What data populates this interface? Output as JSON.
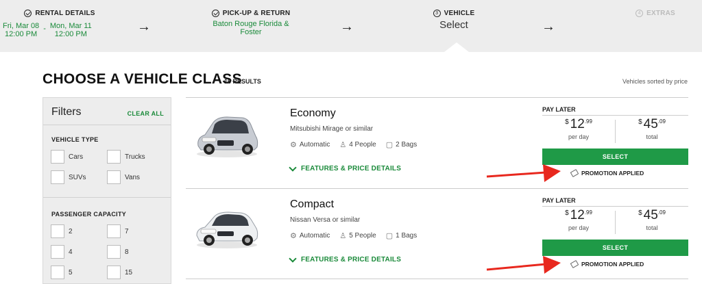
{
  "steps": {
    "rental": {
      "title": "RENTAL DETAILS",
      "from_day": "Fri, Mar 08",
      "from_time": "12:00 PM",
      "sep": "-",
      "to_day": "Mon, Mar 11",
      "to_time": "12:00 PM"
    },
    "pickup": {
      "title": "PICK-UP & RETURN",
      "location": "Baton Rouge Florida & Foster"
    },
    "vehicle": {
      "number": "3",
      "title": "VEHICLE",
      "value": "Select"
    },
    "extras": {
      "number": "4",
      "title": "EXTRAS"
    },
    "arrow_glyph": "→"
  },
  "heading": {
    "title": "CHOOSE A VEHICLE CLASS",
    "results": "16 RESULTS",
    "sorted": "Vehicles sorted by price"
  },
  "filters": {
    "title": "Filters",
    "clear": "CLEAR ALL",
    "vehicle_type": {
      "title": "VEHICLE TYPE",
      "options": [
        "Cars",
        "Trucks",
        "SUVs",
        "Vans"
      ]
    },
    "passenger_capacity": {
      "title": "PASSENGER CAPACITY",
      "options": [
        "2",
        "7",
        "4",
        "8",
        "5",
        "15"
      ]
    }
  },
  "vehicles": [
    {
      "name": "Economy",
      "model": "Mitsubishi Mirage or similar",
      "transmission": "Automatic",
      "people": "4 People",
      "bags": "2 Bags",
      "features": "FEATURES & PRICE DETAILS",
      "pay_label": "PAY LATER",
      "currency": "$",
      "per_day_amt": "12",
      "per_day_cents": ".99",
      "per_day_label": "per day",
      "total_amt": "45",
      "total_cents": ".09",
      "total_label": "total",
      "select": "SELECT",
      "promo": "PROMOTION APPLIED"
    },
    {
      "name": "Compact",
      "model": "Nissan Versa or similar",
      "transmission": "Automatic",
      "people": "5 People",
      "bags": "1 Bags",
      "features": "FEATURES & PRICE DETAILS",
      "pay_label": "PAY LATER",
      "currency": "$",
      "per_day_amt": "12",
      "per_day_cents": ".99",
      "per_day_label": "per day",
      "total_amt": "45",
      "total_cents": ".09",
      "total_label": "total",
      "select": "SELECT",
      "promo": "PROMOTION APPLIED"
    }
  ],
  "colors": {
    "accent": "#1f9a47",
    "accent_text": "#1a8a3a",
    "arrow": "#e8281e",
    "bg_header": "#ededed"
  }
}
